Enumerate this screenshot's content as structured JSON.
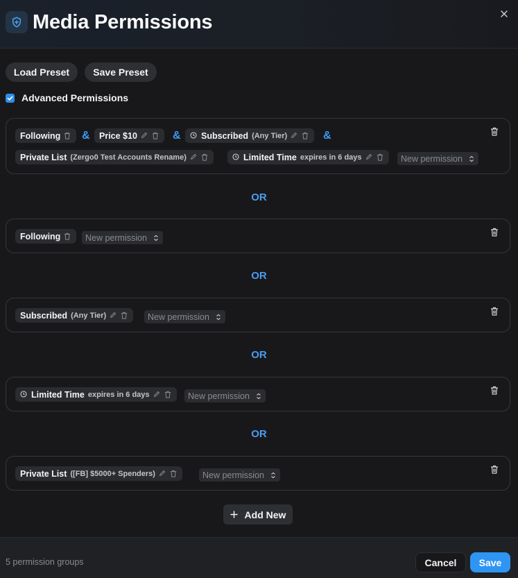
{
  "dialog": {
    "title": "Media Permissions",
    "icon": "shield-plus-icon",
    "close_icon": "close-icon"
  },
  "toolbar": {
    "load_preset": "Load Preset",
    "save_preset": "Save Preset"
  },
  "advanced": {
    "label": "Advanced Permissions",
    "checked": true
  },
  "connector_and": "&",
  "connector_or": "OR",
  "new_permission_placeholder": "New permission",
  "groups": [
    {
      "chips": [
        {
          "name": "Following"
        },
        {
          "name": "Price $10"
        },
        {
          "name": "Subscribed",
          "detail": "(Any Tier)",
          "clock": true
        },
        {
          "name": "Private List",
          "detail": "(Zergo0 Test Accounts Rename)"
        },
        {
          "name": "Limited Time",
          "detail": "expires in 6 days",
          "clock": true
        }
      ]
    },
    {
      "chips": [
        {
          "name": "Following"
        }
      ]
    },
    {
      "chips": [
        {
          "name": "Subscribed",
          "detail": "(Any Tier)"
        }
      ]
    },
    {
      "chips": [
        {
          "name": "Limited Time",
          "detail": "expires in 6 days",
          "clock": true
        }
      ]
    },
    {
      "chips": [
        {
          "name": "Private List",
          "detail": "([FB] $5000+ Spenders)"
        }
      ]
    }
  ],
  "add_new": "Add New",
  "footer": {
    "count_text": "5 permission groups",
    "cancel": "Cancel",
    "save": "Save"
  },
  "colors": {
    "accent": "#2f95f3",
    "background": "#18181b",
    "chip": "#2b2c30"
  }
}
